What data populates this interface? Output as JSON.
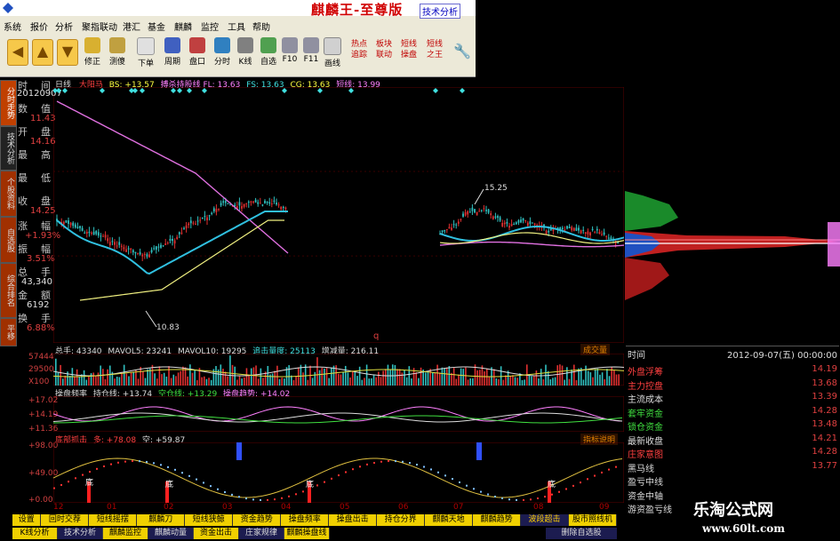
{
  "window": {
    "title": "麒麟王-至尊版",
    "tag": "技术分析",
    "menu": [
      "系统",
      "报价",
      "分析",
      "聚指联动",
      "港汇",
      "基金",
      "麒麟",
      "监控",
      "工具",
      "帮助"
    ]
  },
  "toolbar": {
    "buttons": [
      "修正",
      "测傻",
      "下单",
      "周期",
      "盘口",
      "分时",
      "K线",
      "自选",
      "F10",
      "F11",
      "画线"
    ],
    "red_buttons": [
      "热点追踪",
      "板块联动",
      "短线操盘",
      "短线之王"
    ]
  },
  "left_tabs": [
    "分时走势",
    "技术分析",
    "个股资料",
    "自选股",
    "综合排名",
    "平移"
  ],
  "left_panel": {
    "time_label": "时",
    "time_label2": "间",
    "date": "20120907",
    "rows": [
      {
        "k": "数",
        "v": "值"
      },
      {
        "k": "开",
        "v": "盘"
      },
      {
        "k": "最",
        "v": "高"
      },
      {
        "k": "最",
        "v": "低"
      },
      {
        "k": "收",
        "v": "盘"
      },
      {
        "k": "涨",
        "v": "幅"
      },
      {
        "k": "振",
        "v": "幅"
      },
      {
        "k": "总",
        "v": "手"
      },
      {
        "k": "金",
        "v": "额"
      },
      {
        "k": "换",
        "v": "手"
      }
    ],
    "values": [
      "11.43",
      "14.16",
      "14.25",
      "+1.93%",
      "3.51%",
      "43,340",
      "6192",
      "6.88%"
    ]
  },
  "main_chart": {
    "header": [
      "日线",
      "大阳马",
      "BS: +13.57",
      "搏杀持股线 FL: 13.63",
      "FS: 13.63",
      "CG: 13.63",
      "短线: 13.99"
    ],
    "label_high": "15.25",
    "label_low": "10.83",
    "x_ticks": [
      "12",
      "01",
      "02",
      "03",
      "04",
      "05",
      "06",
      "07",
      "08",
      "09"
    ],
    "volume_tag": "成交量",
    "q_mark": "q"
  },
  "volume_panel": {
    "header": [
      "总手: 43340",
      "MAVOL5: 23241",
      "MAVOL10: 19295",
      "追击量度: 25113",
      "增减量: 216.11"
    ],
    "y_ticks": [
      "57444",
      "29500",
      "X100"
    ]
  },
  "panel3": {
    "header": [
      "操盘频率",
      "持仓线: +13.74",
      "空仓线: +13.29",
      "操盘趋势: +14.02"
    ],
    "y_ticks": [
      "+17.02",
      "+14.19",
      "+11.36"
    ]
  },
  "panel4": {
    "header": [
      "底部抓击",
      "多: +78.08",
      "空: +59.87"
    ],
    "link": "指标说明",
    "y_ticks": [
      "+98.00",
      "+49.00",
      "+0.00"
    ],
    "bottom_mark": "底"
  },
  "right_panel": {
    "date_row": "2012-09-07(五) 00:00:00",
    "time_label": "时间",
    "rows": [
      {
        "k": "外盘浮筹",
        "v": "14.19"
      },
      {
        "k": "主力控盘",
        "v": "13.68"
      },
      {
        "k": "主流成本",
        "v": "13.39"
      },
      {
        "k": "套牢资金",
        "v": "14.28"
      },
      {
        "k": "锁仓资金",
        "v": "13.48"
      },
      {
        "k": "最新收盘",
        "v": "14.21"
      },
      {
        "k": "庄家意图",
        "v": "14.28"
      },
      {
        "k": "黑马线",
        "v": "13.77"
      },
      {
        "k": "盈亏中线",
        "v": ""
      },
      {
        "k": "资金中轴",
        "v": ""
      },
      {
        "k": "游资盈亏线",
        "v": ""
      }
    ]
  },
  "bottom_tabs_row1": [
    "设置",
    "回时交荐",
    "短线摇摆",
    "麒麟刀",
    "短线狭鲸",
    "资金趋势",
    "操盘频率",
    "操盘出击",
    "持仓分界",
    "麒麟天地",
    "麒麟趋势",
    "波段超击",
    "股市照线机"
  ],
  "bottom_tabs_row2": [
    "K线分析",
    "技术分析",
    "麒麟监控",
    "麒麟动量",
    "资金出击",
    "庄家规律",
    "麒麟操盘线"
  ],
  "bottom_right_btn": "删除自选股",
  "watermark": {
    "line1": "乐淘公式网",
    "line2": "www.60lt.com"
  },
  "chart_data": {
    "type": "candlestick",
    "x_ticks": [
      "12",
      "01",
      "02",
      "03",
      "04",
      "05",
      "06",
      "07",
      "08",
      "09"
    ],
    "annotations": [
      {
        "label": "15.25",
        "kind": "high"
      },
      {
        "label": "10.83",
        "kind": "low"
      }
    ],
    "indicators": {
      "BS": 13.57,
      "FL": 13.63,
      "FS": 13.63,
      "CG": 13.63,
      "短线": 13.99
    }
  },
  "colors": {
    "up": "#e03030",
    "down": "#30c0c0",
    "bg": "#000000",
    "grid": "#5a0000"
  }
}
